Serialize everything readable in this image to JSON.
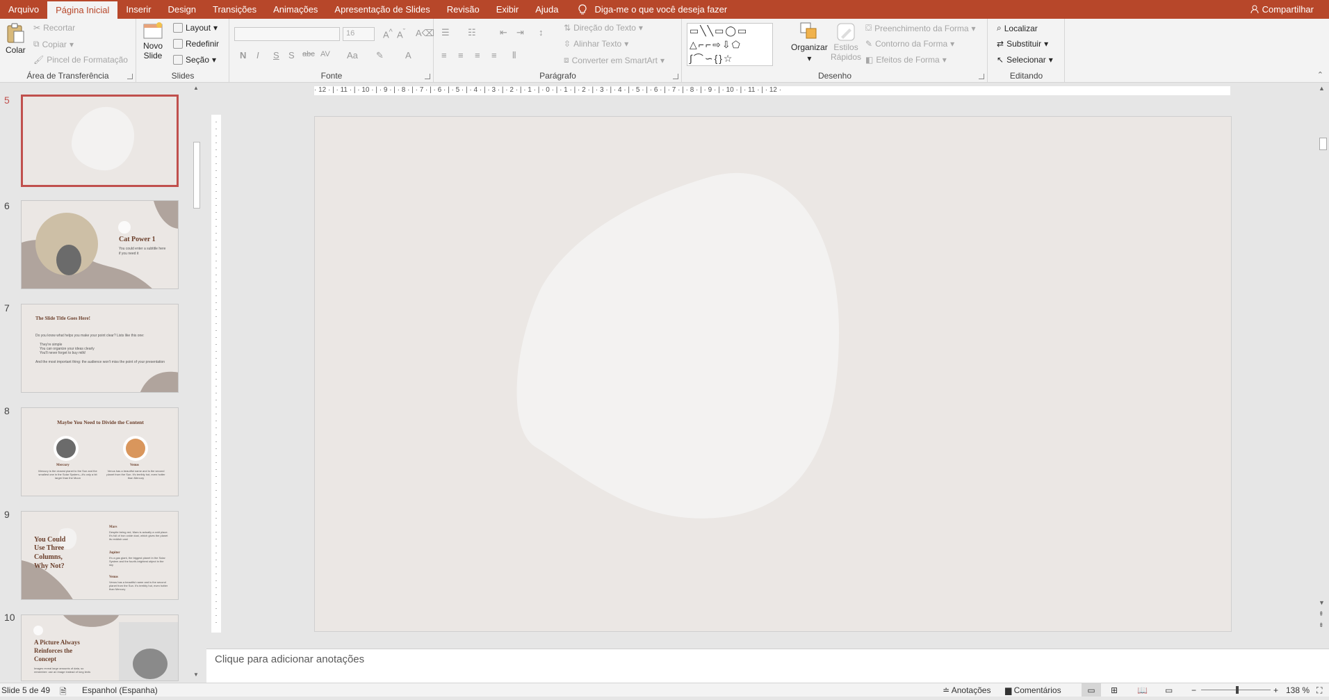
{
  "tabs": [
    "Arquivo",
    "Página Inicial",
    "Inserir",
    "Design",
    "Transições",
    "Animações",
    "Apresentação de Slides",
    "Revisão",
    "Exibir",
    "Ajuda"
  ],
  "tell_me": "Diga-me o que você deseja fazer",
  "share": "Compartilhar",
  "clipboard": {
    "paste": "Colar",
    "cut": "Recortar",
    "copy": "Copiar",
    "format_painter": "Pincel de Formatação",
    "label": "Área de Transferência"
  },
  "slides_group": {
    "new_slide_1": "Novo",
    "new_slide_2": "Slide",
    "layout": "Layout",
    "reset": "Redefinir",
    "section": "Seção",
    "label": "Slides"
  },
  "font": {
    "size": "16",
    "label": "Fonte",
    "bold": "N",
    "italic": "I",
    "underline": "S",
    "shadow": "S",
    "strike": "abc",
    "spacing": "AV",
    "case": "Aa",
    "color": "A"
  },
  "paragraph": {
    "text_direction": "Direção do Texto",
    "align_text": "Alinhar Texto",
    "smartart": "Converter em SmartArt",
    "label": "Parágrafo"
  },
  "drawing": {
    "arrange": "Organizar",
    "quick_styles_1": "Estilos",
    "quick_styles_2": "Rápidos",
    "fill": "Preenchimento da Forma",
    "outline": "Contorno da Forma",
    "effects": "Efeitos de Forma",
    "label": "Desenho"
  },
  "editing": {
    "find": "Localizar",
    "replace": "Substituir",
    "select": "Selecionar",
    "label": "Editando"
  },
  "thumbs": [
    {
      "num": "5"
    },
    {
      "num": "6",
      "title": "Cat Power 1",
      "text": "You could enter a subtitle here if you need it"
    },
    {
      "num": "7",
      "title": "The Slide Title Goes Here!",
      "text": "Do you know what helps you make your point clear? Lists like this one:",
      "b1": "They're simple",
      "b2": "You can organize your ideas clearly",
      "b3": "You'll never forget to buy milk!",
      "text2": "And the most important thing: the audience won't miss the point of your presentation"
    },
    {
      "num": "8",
      "title": "Maybe You Need to Divide the Content",
      "c1": "Mercury",
      "c2": "Venus",
      "t1": "Mercury is the closest planet to the Sun and the smallest one in the Solar System—it's only a bit larger than the Moon",
      "t2": "Venus has a beautiful name and is the second planet from the Sun. It's terribly hot, even hotter than Mercury"
    },
    {
      "num": "9",
      "title1": "You Could",
      "title2": "Use Three",
      "title3": "Columns,",
      "title4": "Why Not?",
      "h1": "Mars",
      "h2": "Jupiter",
      "h3": "Venus",
      "t1": "Despite being red, Mars is actually a cold place. It's full of iron oxide dust, which gives the planet its reddish cast",
      "t2": "It's a gas giant, the biggest planet in the Solar System and the fourth-brightest object in the sky",
      "t3": "Venus has a beautiful name and is the second planet from the Sun. It's terribly hot, even hotter than Mercury"
    },
    {
      "num": "10",
      "title1": "A Picture Always",
      "title2": "Reinforces the",
      "title3": "Concept",
      "text": "Images reveal large amounts of data, so remember: use an image instead of long texts"
    }
  ],
  "ruler_h": "· 12 · | · 11 · | · 10 · | · 9 · | · 8 · | · 7 · | · 6 · | · 5 · | · 4 · | · 3 · | · 2 · | · 1 · | · 0 · | · 1 · | · 2 · | · 3 · | · 4 · | · 5 · | · 6 · | · 7 · | · 8 · | · 9 · | · 10 · | · 11 · | · 12 ·",
  "notes_placeholder": "Clique para adicionar anotações",
  "status": {
    "slide": "Slide 5 de 49",
    "language": "Espanhol (Espanha)",
    "notes": "Anotações",
    "comments": "Comentários",
    "zoom": "138 %"
  }
}
